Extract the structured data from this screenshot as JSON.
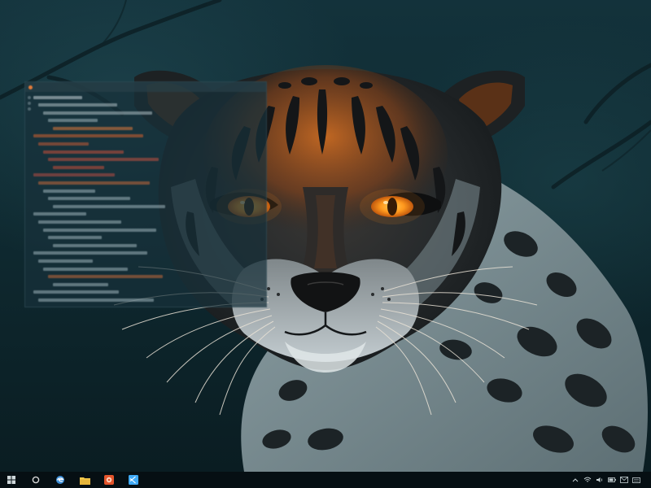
{
  "desktop": {
    "wallpaper_subject": "leopard-wallpaper",
    "accent": "#e8781e",
    "eye_color": "#ffb02a"
  },
  "editor": {
    "title": "",
    "lines": [
      {
        "text": "",
        "color": "#c9d4d7"
      },
      {
        "text": "",
        "color": "#aebfc3"
      },
      {
        "text": "",
        "color": "#aebfc3"
      },
      {
        "text": "",
        "color": "#9fb5ba"
      },
      {
        "text": "",
        "color": "#e07a3a"
      },
      {
        "text": "",
        "color": "#d4632e"
      },
      {
        "text": "",
        "color": "#c55b34"
      },
      {
        "text": "",
        "color": "#c8503a"
      },
      {
        "text": "",
        "color": "#c4523f"
      },
      {
        "text": "",
        "color": "#c8503a"
      },
      {
        "text": "",
        "color": "#b84e44"
      },
      {
        "text": "",
        "color": "#c46a3b"
      },
      {
        "text": "",
        "color": "#9fb5ba"
      },
      {
        "text": "",
        "color": "#9fb5ba"
      },
      {
        "text": "",
        "color": "#9fb5ba"
      },
      {
        "text": "",
        "color": "#9fb5ba"
      },
      {
        "text": "",
        "color": "#9fb5ba"
      },
      {
        "text": "",
        "color": "#9fb5ba"
      },
      {
        "text": "",
        "color": "#9fb5ba"
      },
      {
        "text": "",
        "color": "#9fb5ba"
      },
      {
        "text": "",
        "color": "#9fb5ba"
      },
      {
        "text": "",
        "color": "#9fb5ba"
      },
      {
        "text": "",
        "color": "#9fb5ba"
      },
      {
        "text": "",
        "color": "#c46a3b"
      },
      {
        "text": "",
        "color": "#9fb5ba"
      },
      {
        "text": "",
        "color": "#9fb5ba"
      },
      {
        "text": "",
        "color": "#9fb5ba"
      },
      {
        "text": "",
        "color": "#9fb5ba"
      }
    ]
  },
  "taskbar": {
    "apps": [
      {
        "name": "start-icon",
        "color": "#cfd8db"
      },
      {
        "name": "cortana-icon",
        "color": "#d8d8d8"
      },
      {
        "name": "browser-icon",
        "color": "#3d8fd8"
      },
      {
        "name": "file-explorer-icon",
        "color": "#f2c94c"
      },
      {
        "name": "media-player-icon",
        "color": "#e3542b"
      },
      {
        "name": "code-editor-icon",
        "color": "#3fa9f5"
      }
    ],
    "tray": [
      {
        "name": "chevron-up-icon"
      },
      {
        "name": "network-icon"
      },
      {
        "name": "volume-icon"
      },
      {
        "name": "battery-icon"
      },
      {
        "name": "message-icon"
      },
      {
        "name": "keyboard-icon"
      }
    ],
    "clock": {
      "time": "",
      "date": ""
    }
  }
}
